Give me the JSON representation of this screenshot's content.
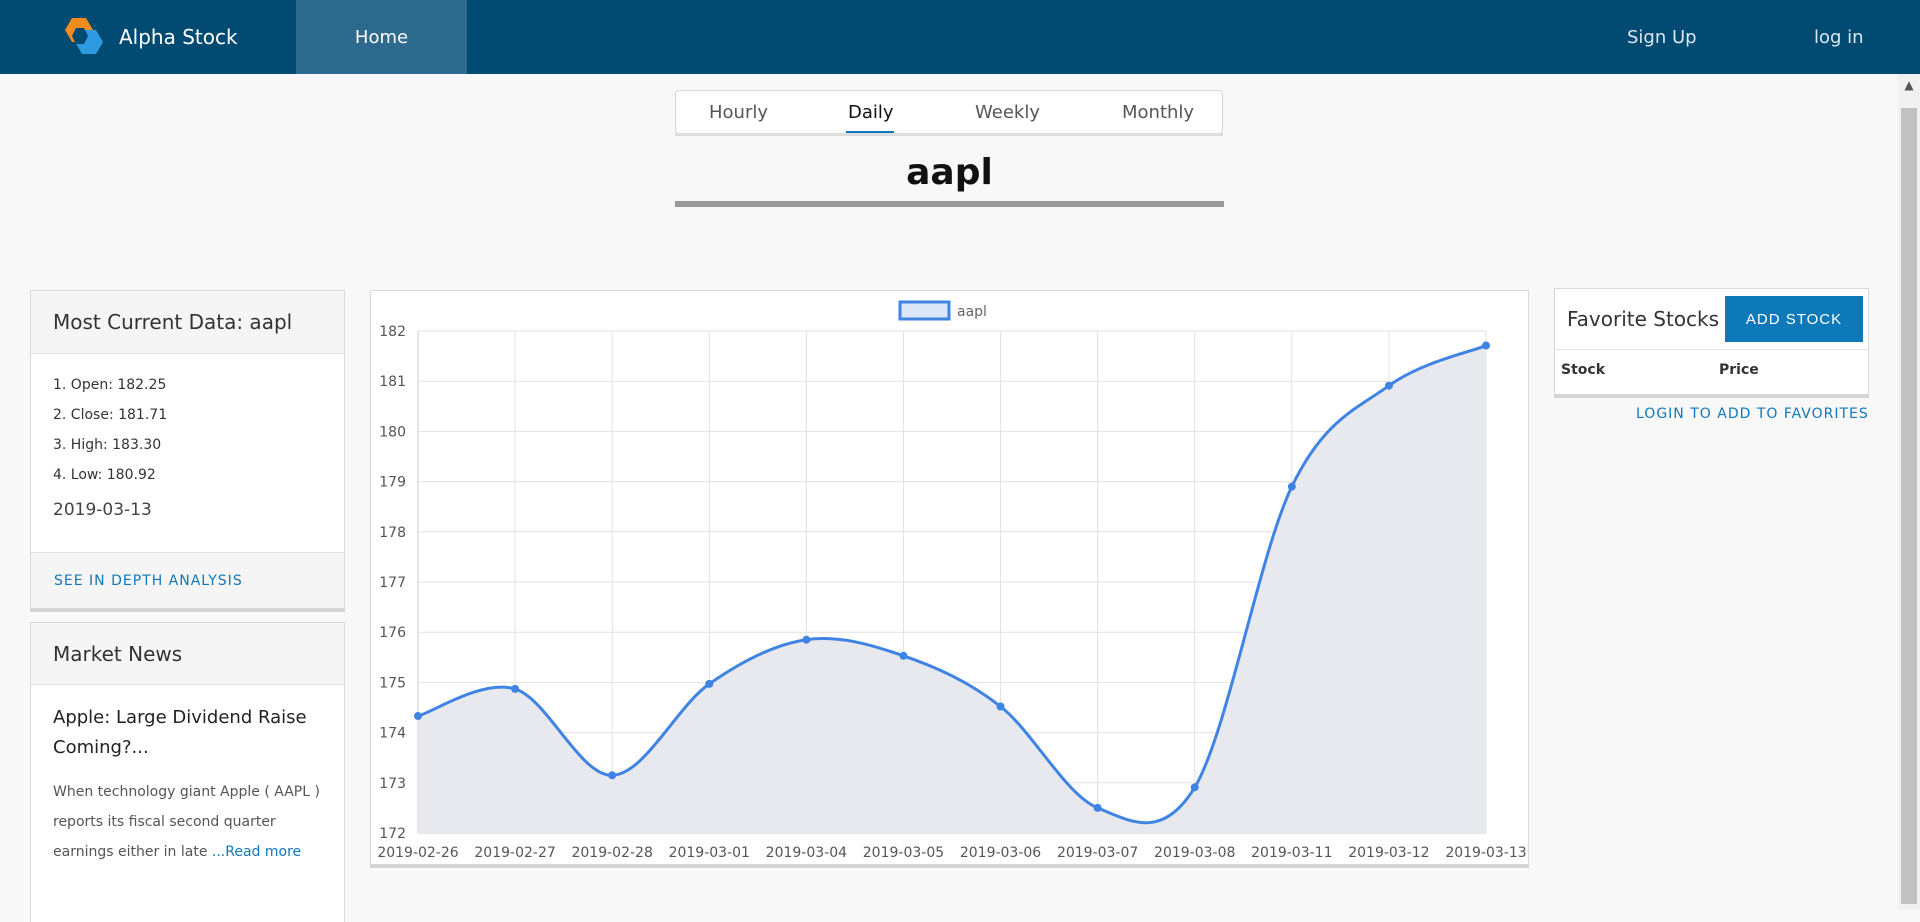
{
  "header": {
    "brand": "Alpha Stock",
    "nav_home": "Home",
    "sign_up": "Sign Up",
    "log_in": "log in"
  },
  "tabs": [
    "Hourly",
    "Daily",
    "Weekly",
    "Monthly"
  ],
  "active_tab": "Daily",
  "ticker": "aapl",
  "current": {
    "title": "Most Current Data: aapl",
    "open": "1. Open: 182.25",
    "close": "2. Close: 181.71",
    "high": "3. High: 183.30",
    "low": "4. Low: 180.92",
    "date": "2019-03-13",
    "analysis_link": "SEE IN DEPTH ANALYSIS"
  },
  "news": {
    "title": "Market News",
    "headline": "Apple: Large Dividend Raise Coming?...",
    "body": "When technology giant Apple ( AAPL ) reports its fiscal second quarter earnings either in late ",
    "read_more": "...Read more"
  },
  "favorites": {
    "title": "Favorite Stocks",
    "add_button": "ADD STOCK",
    "col_stock": "Stock",
    "col_price": "Price",
    "login_link": "LOGIN TO ADD TO FAVORITES"
  },
  "colors": {
    "header_bg": "#014b72",
    "accent": "#1177bb",
    "line": "#3f84e5",
    "area": "#e8e9ee"
  },
  "chart_data": {
    "type": "area",
    "legend": "aapl",
    "x": [
      "2019-02-26",
      "2019-02-27",
      "2019-02-28",
      "2019-03-01",
      "2019-03-04",
      "2019-03-05",
      "2019-03-06",
      "2019-03-07",
      "2019-03-08",
      "2019-03-11",
      "2019-03-12",
      "2019-03-13"
    ],
    "series": [
      {
        "name": "aapl",
        "values": [
          174.33,
          174.87,
          173.15,
          174.97,
          175.85,
          175.53,
          174.52,
          172.5,
          172.91,
          178.9,
          180.91,
          181.71
        ]
      }
    ],
    "ylim": [
      172,
      182
    ],
    "yticks": [
      172,
      173,
      174,
      175,
      176,
      177,
      178,
      179,
      180,
      181,
      182
    ],
    "grid": true,
    "legend_position": "top"
  }
}
